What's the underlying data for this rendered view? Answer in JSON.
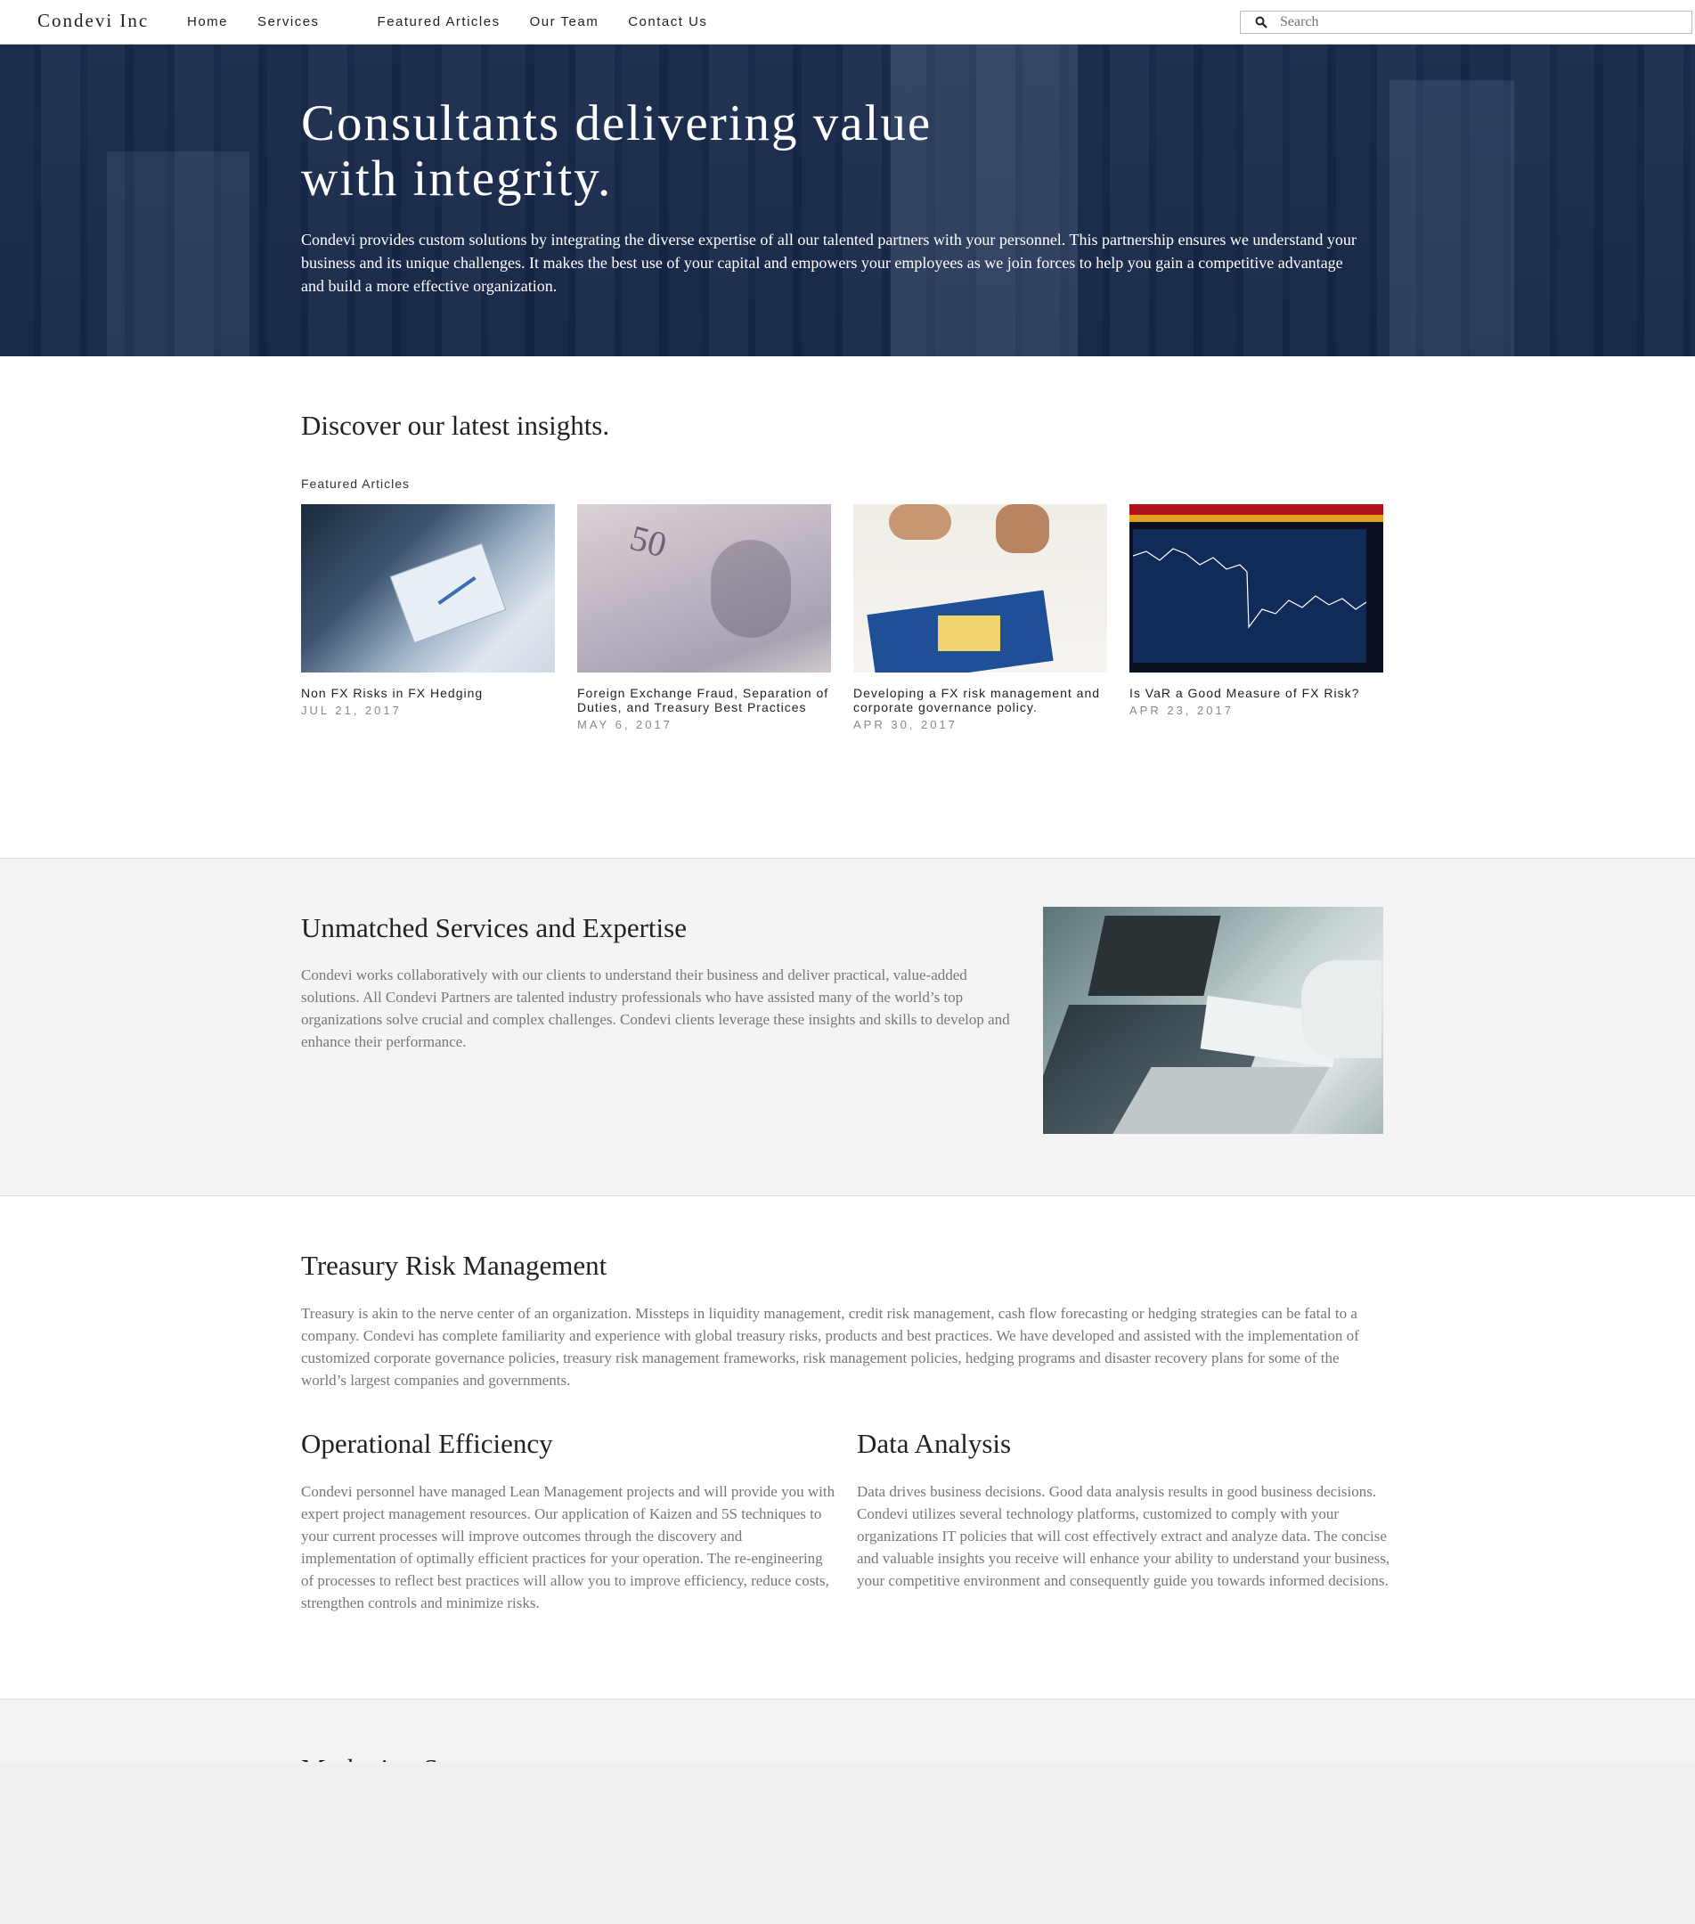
{
  "nav": {
    "brand": "Condevi Inc",
    "links": [
      "Home",
      "Services",
      "Featured Articles",
      "Our Team",
      "Contact Us"
    ],
    "search_placeholder": "Search"
  },
  "hero": {
    "title": "Consultants delivering value with integrity.",
    "text": "Condevi provides custom solutions by integrating the diverse expertise of all our talented partners with your personnel.  This partnership ensures we understand your business and its unique challenges.  It makes the best use of your capital and empowers your employees as we join forces to help you gain a competitive advantage and build a more effective organization."
  },
  "insights": {
    "title": "Discover our latest insights.",
    "featured_label": "Featured Articles",
    "articles": [
      {
        "title": "Non FX Risks in FX Hedging",
        "date": "JUL 21, 2017"
      },
      {
        "title": "Foreign Exchange Fraud, Separation of Duties, and Treasury Best Practices",
        "date": "MAY 6, 2017"
      },
      {
        "title": "Developing a FX risk management and corporate governance policy.",
        "date": "APR 30, 2017"
      },
      {
        "title": "Is VaR a Good Measure of FX Risk?",
        "date": "APR 23, 2017"
      }
    ]
  },
  "services": {
    "title": "Unmatched Services and Expertise",
    "text": "Condevi works collaboratively with our clients to understand their business and deliver practical, value-added solutions. All Condevi Partners are talented industry professionals who have assisted many of the world’s top organizations solve crucial and complex challenges. Condevi clients leverage these insights and skills to develop and enhance their performance."
  },
  "treasury": {
    "title": "Treasury Risk Management",
    "text": "Treasury is akin to the nerve center of an organization. Missteps in liquidity management, credit risk management, cash flow forecasting or hedging strategies can be fatal to a company.  Condevi has complete familiarity and experience with global treasury risks, products and best practices.  We have developed and assisted with the implementation of customized corporate governance policies, treasury risk management frameworks, risk management policies, hedging programs and disaster recovery plans for some of the world’s largest companies and governments."
  },
  "operations": {
    "title": "Operational Efficiency",
    "text": "Condevi personnel have managed Lean Management projects and will provide you with expert project management resources.  Our application of Kaizen and 5S techniques to your current processes will improve outcomes through the discovery and implementation of optimally efficient practices for your operation.  The re-engineering of processes to reflect best practices will allow you to improve efficiency, reduce costs, strengthen controls and minimize risks."
  },
  "data_analysis": {
    "title": "Data Analysis",
    "text": "Data drives business decisions.  Good data analysis results in good business decisions.  Condevi utilizes several technology platforms, customized to comply with your organizations IT policies that will cost effectively extract and analyze data. The concise and valuable insights you receive will enhance your ability to understand your business, your competitive environment and consequently guide you towards informed decisions."
  },
  "marketing": {
    "title": "Marketing Strategy"
  },
  "colors": {
    "hero_overlay": "#14264a",
    "body_text": "#777777",
    "section_bg": "#f4f4f4"
  }
}
